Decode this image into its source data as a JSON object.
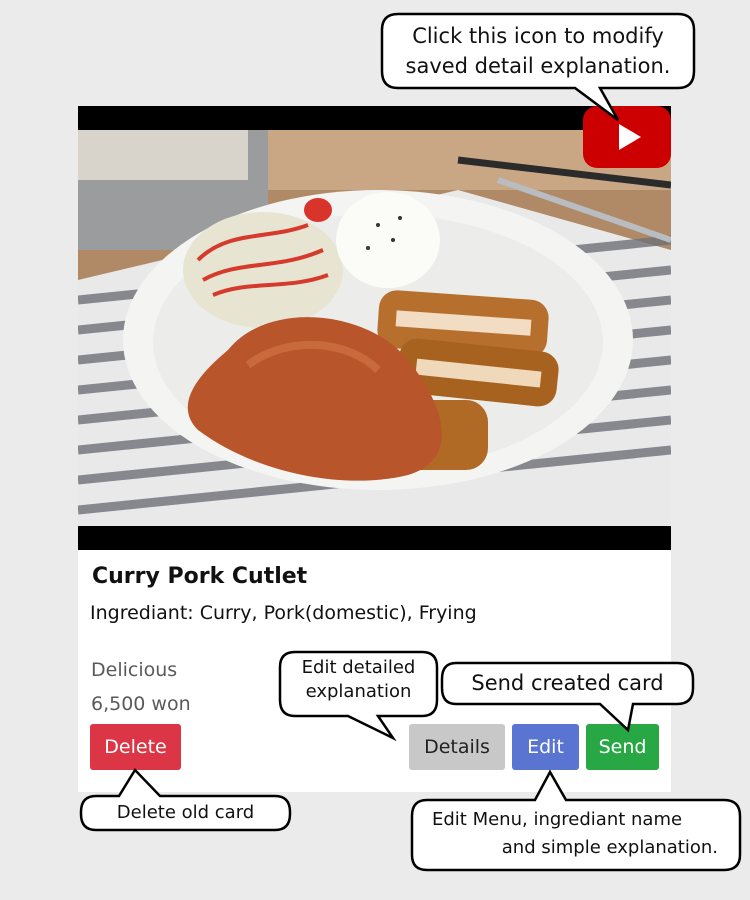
{
  "card": {
    "title": "Curry Pork Cutlet",
    "ingredient": "Ingrediant: Curry, Pork(domestic), Frying",
    "taste": "Delicious",
    "price": "6,500 won",
    "buttons": {
      "delete": "Delete",
      "details": "Details",
      "edit": "Edit",
      "send": "Send"
    },
    "video_icon": "youtube-play-icon"
  },
  "callouts": {
    "icon_line1": "Click this icon to modify",
    "icon_line2": "saved detail explanation.",
    "details_line1": "Edit detailed",
    "details_line2": "explanation",
    "send": "Send created card",
    "delete": "Delete old card",
    "edit_line1": "Edit Menu, ingrediant name",
    "edit_line2": "and simple explanation."
  },
  "colors": {
    "delete": "#dc3545",
    "details": "#c8c8c8",
    "edit": "#5a74d1",
    "send": "#28a745",
    "youtube": "#cc0000"
  }
}
